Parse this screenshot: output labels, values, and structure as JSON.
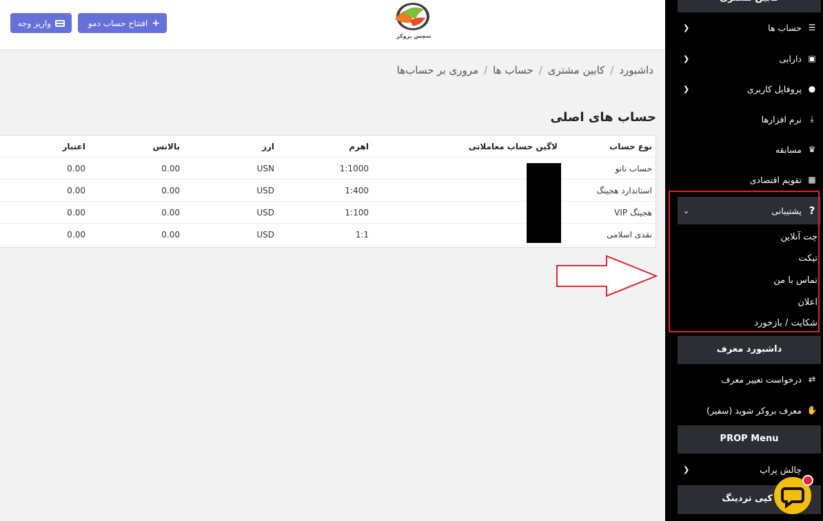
{
  "header": {
    "deposit_label": "واریز وجه",
    "demo_label": "افتتاح حساب دمو",
    "logo_text": "سچس بروکر"
  },
  "breadcrumb": [
    "داشبورد",
    "کابین مشتری",
    "حساب ها",
    "مروری بر حساب‌ها"
  ],
  "section_title": "حساب های اصلی",
  "table": {
    "columns": [
      "نوع حساب",
      "لاگین حساب معاملاتی",
      "اهرم",
      "ارز",
      "بالانس",
      "اعتبار"
    ],
    "rows": [
      {
        "type": "حساب نانو",
        "login": "",
        "leverage": "1:1000",
        "currency": "USN",
        "balance": "0.00",
        "credit": "0.00"
      },
      {
        "type": "استاندارد هجینگ",
        "login": "",
        "leverage": "1:400",
        "currency": "USD",
        "balance": "0.00",
        "credit": "0.00"
      },
      {
        "type": "VIP هجینگ",
        "login": "",
        "leverage": "1:100",
        "currency": "USD",
        "balance": "0.00",
        "credit": "0.00"
      },
      {
        "type": "نقدی اسلامی",
        "login": "",
        "leverage": "1:1",
        "currency": "USD",
        "balance": "0.00",
        "credit": "0.00"
      }
    ]
  },
  "sidebar": {
    "top_head": "کابین مشتری",
    "items": [
      {
        "label": "حساب ها",
        "icon": "list-icon"
      },
      {
        "label": "دارایی",
        "icon": "wallet-icon"
      },
      {
        "label": "پروفایل کاربری",
        "icon": "user-icon"
      },
      {
        "label": "نرم افزارها",
        "icon": "download-icon"
      },
      {
        "label": "مسابقه",
        "icon": "trophy-icon"
      },
      {
        "label": "تقویم اقتصادی",
        "icon": "calendar-icon"
      }
    ],
    "support": {
      "label": "پشتیبانی",
      "icon": "question-icon",
      "sub": [
        "چت آنلاین",
        "تیکت",
        "تماس با من",
        "اعلان",
        "شکایت / بازخورد"
      ]
    },
    "referrer_head": "داشبورد معرف",
    "referrer_items": [
      {
        "label": "درخواست تغییر معرف",
        "icon": "exchange-icon"
      },
      {
        "label": "معرف بروکر شوید (سفیر)",
        "icon": "handshake-icon"
      }
    ],
    "prop_head": "PROP Menu",
    "prop_items": [
      {
        "label": "چالش پراپ"
      }
    ],
    "bottom_head": "کپی تردینگ"
  },
  "colors": {
    "accent": "#6570d8",
    "sidebar_bg": "#000000",
    "sidebar_section": "#2b2f33",
    "highlight": "#e0252f",
    "chat": "#f6be0c"
  }
}
